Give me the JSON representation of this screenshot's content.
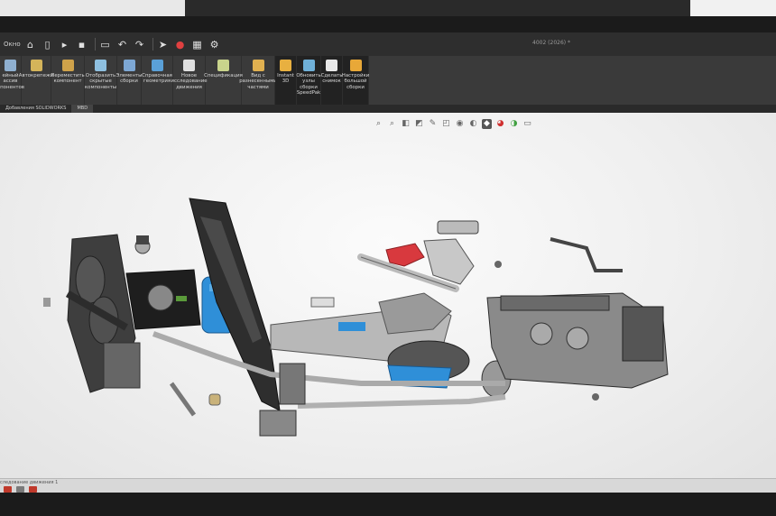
{
  "window": {
    "menu_label": "Окно",
    "document_title": "4002 (2026) *"
  },
  "quick_access": [
    {
      "icon": "home-icon",
      "glyph": "⌂"
    },
    {
      "icon": "new-file-icon",
      "glyph": "▯"
    },
    {
      "icon": "open-icon",
      "glyph": "▸"
    },
    {
      "icon": "save-icon",
      "glyph": "▪"
    },
    {
      "icon": "print-icon",
      "glyph": "▭"
    },
    {
      "icon": "undo-icon",
      "glyph": "↶"
    },
    {
      "icon": "redo-icon",
      "glyph": "↷"
    },
    {
      "icon": "select-cursor-icon",
      "glyph": "➤"
    },
    {
      "icon": "traffic-light-icon",
      "glyph": "●"
    },
    {
      "icon": "file-properties-icon",
      "glyph": "▦"
    },
    {
      "icon": "settings-gear-icon",
      "glyph": "⚙"
    }
  ],
  "ribbon": [
    {
      "name": "ribbon-linear-pattern",
      "label": "ейный\nассив\nмпонентов",
      "icon": "linear-pattern-icon",
      "color": "#8fb0d0"
    },
    {
      "name": "ribbon-mates",
      "label": "Автокрепежи",
      "icon": "mates-icon",
      "color": "#d4b45a"
    },
    {
      "name": "ribbon-move-component",
      "label": "Переместить\nкомпонент",
      "icon": "move-component-icon",
      "color": "#cfa24a"
    },
    {
      "name": "ribbon-show-hidden",
      "label": "Отобразить\nскрытые\nкомпоненты",
      "icon": "show-hidden-icon",
      "color": "#8ec0e0"
    },
    {
      "name": "ribbon-assembly-features",
      "label": "Элементы\nсборки",
      "icon": "assembly-features-icon",
      "color": "#7da7d4"
    },
    {
      "name": "ribbon-reference-geometry",
      "label": "Справочная\nгеометрия",
      "icon": "reference-geometry-icon",
      "color": "#5aa0d8"
    },
    {
      "name": "ribbon-motion-study",
      "label": "Новое\nисследование\nдвижения",
      "icon": "motion-study-icon",
      "color": "#e0e0e0"
    },
    {
      "name": "ribbon-bom",
      "label": "Спецификация",
      "icon": "bom-icon",
      "color": "#c9d48c"
    },
    {
      "name": "ribbon-exploded-view",
      "label": "Вид с\nразнесенными\nчастями",
      "icon": "exploded-view-icon",
      "color": "#e0b050"
    },
    {
      "name": "ribbon-instant3d",
      "label": "Instant\n3D",
      "icon": "instant3d-icon",
      "color": "#e8b040"
    },
    {
      "name": "ribbon-speedpak",
      "label": "Обновить\nузлы\nсборки\nSpeedPak",
      "icon": "speedpak-icon",
      "color": "#6fb0d8"
    },
    {
      "name": "ribbon-snapshot",
      "label": "Сделать\nснимок",
      "icon": "snapshot-icon",
      "color": "#e8e8e8"
    },
    {
      "name": "ribbon-large-assembly",
      "label": "Настройки\nбольшой\nсборки",
      "icon": "large-assembly-icon",
      "color": "#e8a838"
    }
  ],
  "tabs": [
    {
      "label": "Добавления SOLIDWORKS"
    },
    {
      "label": "MBD"
    }
  ],
  "status": {
    "motion_tab": "следование движения 1"
  },
  "colors": {
    "accent_blue": "#2f8fd8",
    "accent_red": "#d8393e",
    "model_gray": "#5a5a5a"
  }
}
